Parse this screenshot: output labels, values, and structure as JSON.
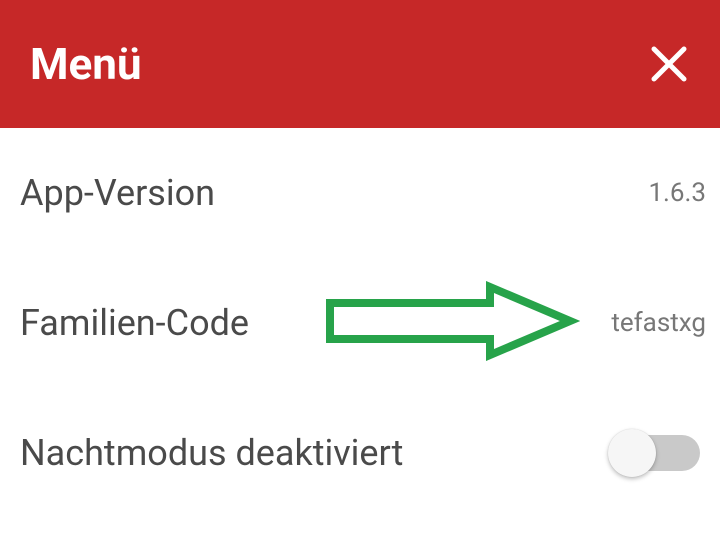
{
  "header": {
    "title": "Menü"
  },
  "rows": {
    "app_version": {
      "label": "App-Version",
      "value": "1.6.3"
    },
    "family_code": {
      "label": "Familien-Code",
      "value": "tefastxg"
    },
    "night_mode": {
      "label": "Nachtmodus deaktiviert",
      "enabled": false
    }
  },
  "colors": {
    "header_bg": "#c62828",
    "arrow": "#27a34a"
  }
}
